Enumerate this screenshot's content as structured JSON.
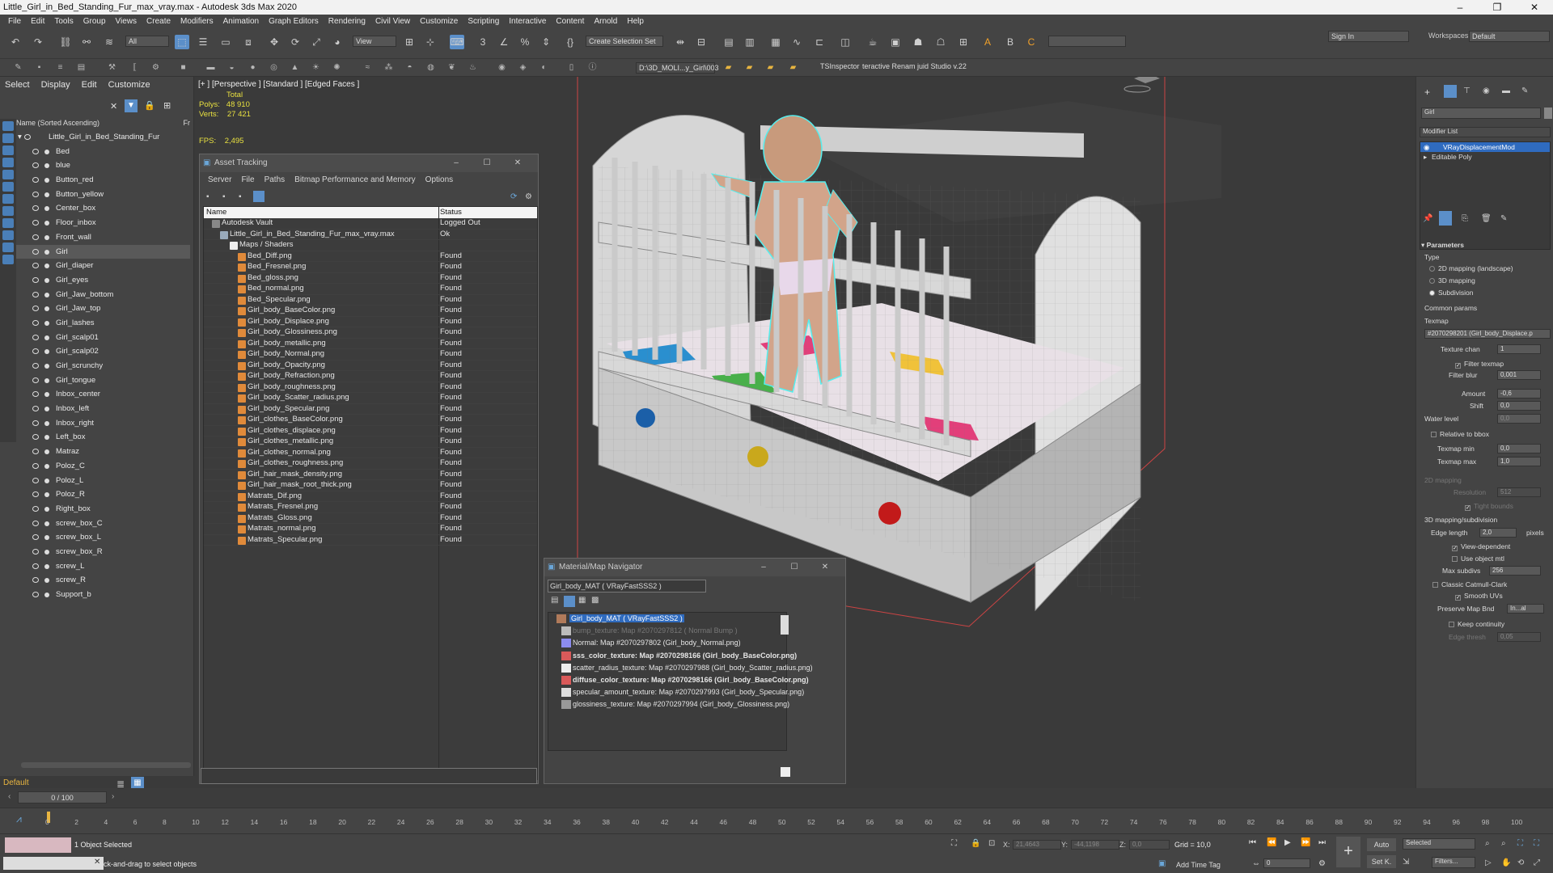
{
  "window": {
    "title": "Little_Girl_in_Bed_Standing_Fur_max_vray.max - Autodesk 3ds Max 2020"
  },
  "menu": [
    "File",
    "Edit",
    "Tools",
    "Group",
    "Views",
    "Create",
    "Modifiers",
    "Animation",
    "Graph Editors",
    "Rendering",
    "Civil View",
    "Customize",
    "Scripting",
    "Interactive",
    "Content",
    "Arnold",
    "Help"
  ],
  "toolbar": {
    "selection_filter": "All",
    "ref_coord": "View",
    "named_selection": "Create Selection Set",
    "project_path": "D:\\3D_MOLI...y_Girl\\003",
    "tsinspector": "TSInspector",
    "renamer": "teractive Renam juid Studio v.22",
    "sign_in": "Sign In",
    "workspaces_label": "Workspaces:",
    "workspace_value": "Default"
  },
  "explorer": {
    "tabs": [
      "Select",
      "Display",
      "Edit",
      "Customize"
    ],
    "sort_header": "Name (Sorted Ascending)",
    "frozen_header": "Fr",
    "root": "Little_Girl_in_Bed_Standing_Fur",
    "items": [
      "Bed",
      "blue",
      "Button_red",
      "Button_yellow",
      "Center_box",
      "Floor_inbox",
      "Front_wall",
      "Girl",
      "Girl_diaper",
      "Girl_eyes",
      "Girl_Jaw_bottom",
      "Girl_Jaw_top",
      "Girl_lashes",
      "Girl_scalp01",
      "Girl_scalp02",
      "Girl_scrunchy",
      "Girl_tongue",
      "Inbox_center",
      "Inbox_left",
      "Inbox_right",
      "Left_box",
      "Matraz",
      "Poloz_C",
      "Poloz_L",
      "Poloz_R",
      "Right_box",
      "screw_box_C",
      "screw_box_L",
      "screw_box_R",
      "screw_L",
      "screw_R",
      "Support_b"
    ],
    "selected": "Girl",
    "layer": "Default"
  },
  "viewport": {
    "label": "[+ ] [Perspective ] [Standard ] [Edged Faces ]",
    "total_label": "Total",
    "polys_label": "Polys:",
    "polys": "48 910",
    "verts_label": "Verts:",
    "verts": "27 421",
    "fps_label": "FPS:",
    "fps": "2,495"
  },
  "asset_tracking": {
    "title": "Asset Tracking",
    "menu": [
      "Server",
      "File",
      "Paths",
      "Bitmap Performance and Memory",
      "Options"
    ],
    "col_name": "Name",
    "col_status": "Status",
    "vault": {
      "name": "Autodesk Vault",
      "status": "Logged Out"
    },
    "file": {
      "name": "Little_Girl_in_Bed_Standing_Fur_max_vray.max",
      "status": "Ok"
    },
    "folder": "Maps / Shaders",
    "maps": [
      {
        "name": "Bed_Diff.png",
        "status": "Found"
      },
      {
        "name": "Bed_Fresnel.png",
        "status": "Found"
      },
      {
        "name": "Bed_gloss.png",
        "status": "Found"
      },
      {
        "name": "Bed_normal.png",
        "status": "Found"
      },
      {
        "name": "Bed_Specular.png",
        "status": "Found"
      },
      {
        "name": "Girl_body_BaseColor.png",
        "status": "Found"
      },
      {
        "name": "Girl_body_Displace.png",
        "status": "Found"
      },
      {
        "name": "Girl_body_Glossiness.png",
        "status": "Found"
      },
      {
        "name": "Girl_body_metallic.png",
        "status": "Found"
      },
      {
        "name": "Girl_body_Normal.png",
        "status": "Found"
      },
      {
        "name": "Girl_body_Opacity.png",
        "status": "Found"
      },
      {
        "name": "Girl_body_Refraction.png",
        "status": "Found"
      },
      {
        "name": "Girl_body_roughness.png",
        "status": "Found"
      },
      {
        "name": "Girl_body_Scatter_radius.png",
        "status": "Found"
      },
      {
        "name": "Girl_body_Specular.png",
        "status": "Found"
      },
      {
        "name": "Girl_clothes_BaseColor.png",
        "status": "Found"
      },
      {
        "name": "Girl_clothes_displace.png",
        "status": "Found"
      },
      {
        "name": "Girl_clothes_metallic.png",
        "status": "Found"
      },
      {
        "name": "Girl_clothes_normal.png",
        "status": "Found"
      },
      {
        "name": "Girl_clothes_roughness.png",
        "status": "Found"
      },
      {
        "name": "Girl_hair_mask_density.png",
        "status": "Found"
      },
      {
        "name": "Girl_hair_mask_root_thick.png",
        "status": "Found"
      },
      {
        "name": "Matrats_Dif.png",
        "status": "Found"
      },
      {
        "name": "Matrats_Fresnel.png",
        "status": "Found"
      },
      {
        "name": "Matrats_Gloss.png",
        "status": "Found"
      },
      {
        "name": "Matrats_normal.png",
        "status": "Found"
      },
      {
        "name": "Matrats_Specular.png",
        "status": "Found"
      }
    ]
  },
  "material_navigator": {
    "title": "Material/Map Navigator",
    "current": "Girl_body_MAT  ( VRayFastSSS2 )",
    "root": "Girl_body_MAT  ( VRayFastSSS2 )",
    "items": [
      {
        "text": "bump_texture: Map #2070297812  ( Normal Bump )",
        "style": "dim"
      },
      {
        "text": "Normal: Map #2070297802 (Girl_body_Normal.png)",
        "style": "normal"
      },
      {
        "text": "sss_color_texture: Map #2070298166 (Girl_body_BaseColor.png)",
        "style": "bold"
      },
      {
        "text": "scatter_radius_texture: Map #2070297988 (Girl_body_Scatter_radius.png)",
        "style": "normal"
      },
      {
        "text": "diffuse_color_texture: Map #2070298166 (Girl_body_BaseColor.png)",
        "style": "bold"
      },
      {
        "text": "specular_amount_texture: Map #2070297993 (Girl_body_Specular.png)",
        "style": "normal"
      },
      {
        "text": "glossiness_texture: Map #2070297994 (Girl_body_Glossiness.png)",
        "style": "normal"
      }
    ]
  },
  "command_panel": {
    "object_name": "Girl",
    "modifier_list": "Modifier List",
    "stack": [
      "VRayDisplacementMod",
      "Editable Poly"
    ],
    "parameters": "Parameters",
    "type_label": "Type",
    "type_options": [
      "2D mapping (landscape)",
      "3D mapping",
      "Subdivision"
    ],
    "common_params": "Common params",
    "texmap_label": "Texmap",
    "texmap_value": "#2070298201 (Girl_body_Displace.p",
    "texture_chan_label": "Texture chan",
    "texture_chan": "1",
    "filter_texmap": "Filter texmap",
    "filter_blur_label": "Filter blur",
    "filter_blur": "0,001",
    "amount_label": "Amount",
    "amount": "-0,6",
    "shift_label": "Shift",
    "shift": "0,0",
    "water_level_label": "Water level",
    "water_level": "0,0",
    "relative_bbox": "Relative to bbox",
    "texmap_min_label": "Texmap min",
    "texmap_min": "0,0",
    "texmap_max_label": "Texmap max",
    "texmap_max": "1,0",
    "mapping2d": "2D mapping",
    "resolution_label": "Resolution",
    "resolution": "512",
    "tight_bounds": "Tight bounds",
    "mapping3d": "3D mapping/subdivision",
    "edge_length_label": "Edge length",
    "edge_length": "2,0",
    "pixels": "pixels",
    "view_dependent": "View-dependent",
    "use_object_mtl": "Use object mtl",
    "max_subdivs_label": "Max subdivs",
    "max_subdivs": "256",
    "classic_catmull": "Classic Catmull-Clark",
    "smooth_uvs": "Smooth UVs",
    "preserve_map_label": "Preserve Map Bnd",
    "preserve_map": "In...al",
    "keep_continuity": "Keep continuity",
    "edge_thresh_label": "Edge thresh",
    "edge_thresh": "0,05"
  },
  "timeline": {
    "frame": "0 / 100",
    "ticks": [
      "0",
      "2",
      "4",
      "6",
      "8",
      "10",
      "12",
      "14",
      "16",
      "18",
      "20",
      "22",
      "24",
      "26",
      "28",
      "30",
      "32",
      "34",
      "36",
      "38",
      "40",
      "42",
      "44",
      "46",
      "48",
      "50",
      "52",
      "54",
      "56",
      "58",
      "60",
      "62",
      "64",
      "66",
      "68",
      "70",
      "72",
      "74",
      "76",
      "78",
      "80",
      "82",
      "84",
      "86",
      "88",
      "90",
      "92",
      "94",
      "96",
      "98",
      "100"
    ]
  },
  "status": {
    "selected": "1 Object Selected",
    "prompt": "ck-and-drag to select objects",
    "x_label": "X:",
    "x": "21,4643",
    "y_label": "Y:",
    "y": "-44,1198",
    "z_label": "Z:",
    "z": "0,0",
    "grid": "Grid = 10,0",
    "add_time_tag": "Add Time Tag",
    "auto": "Auto",
    "set_k": "Set K.",
    "selected_dd": "Selected",
    "filters": "Filters...",
    "frame_spinner": "0"
  }
}
